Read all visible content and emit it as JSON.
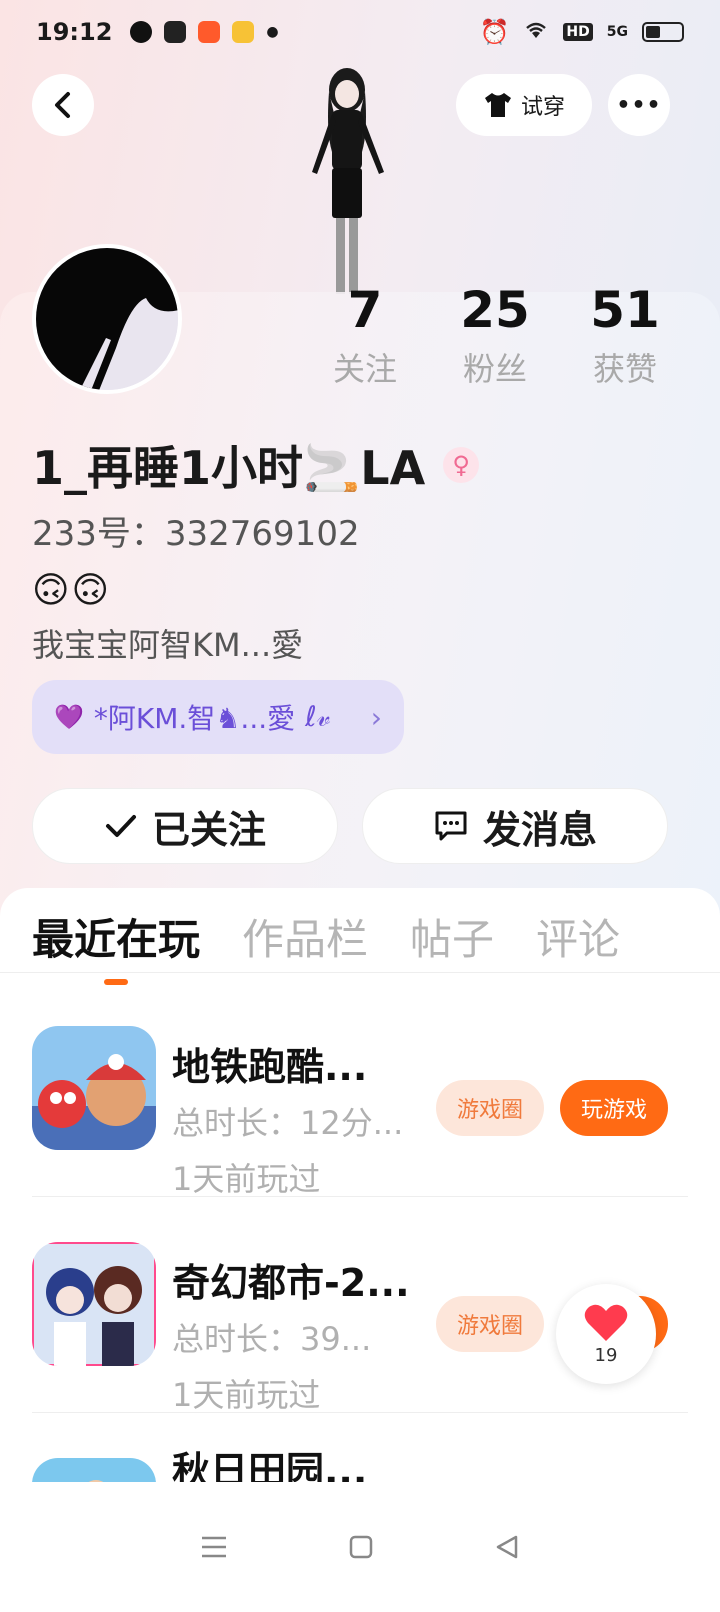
{
  "status_bar": {
    "time": "19:12",
    "network": "5G",
    "hd": "HD"
  },
  "header": {
    "try_on_label": "试穿",
    "more_label": "•••"
  },
  "stats": [
    {
      "value": "7",
      "label": "关注"
    },
    {
      "value": "25",
      "label": "粉丝"
    },
    {
      "value": "51",
      "label": "获赞"
    }
  ],
  "profile": {
    "username": "1_再睡1小时🚬LA",
    "gender_symbol": "♀",
    "uid": "233号：332769102",
    "emojis": "🙃🙃",
    "bio": "我宝宝阿智KM...愛",
    "tag_text": "*阿KM.智♞...愛",
    "tag_chevron": "›"
  },
  "actions": {
    "follow_label": "已关注",
    "message_label": "发消息"
  },
  "tabs": [
    "最近在玩",
    "作品栏",
    "帖子",
    "评论"
  ],
  "games": [
    {
      "name": "地铁跑酷...",
      "duration": "总时长：12分...",
      "last_played": "1天前玩过",
      "circle_label": "游戏圈",
      "play_label": "玩游戏"
    },
    {
      "name": "奇幻都市-2...",
      "duration": "总时长：39...",
      "last_played": "1天前玩过",
      "circle_label": "游戏圈",
      "play_label": "玩游戏"
    },
    {
      "name": "秋日田园...",
      "duration": "",
      "last_played": "",
      "circle_label": "",
      "play_label": ""
    }
  ],
  "like_fab": {
    "count": "19"
  },
  "colors": {
    "accent": "#ff6a14",
    "tag_purple": "#6b4fd8",
    "gender_pink": "#f06a92"
  }
}
